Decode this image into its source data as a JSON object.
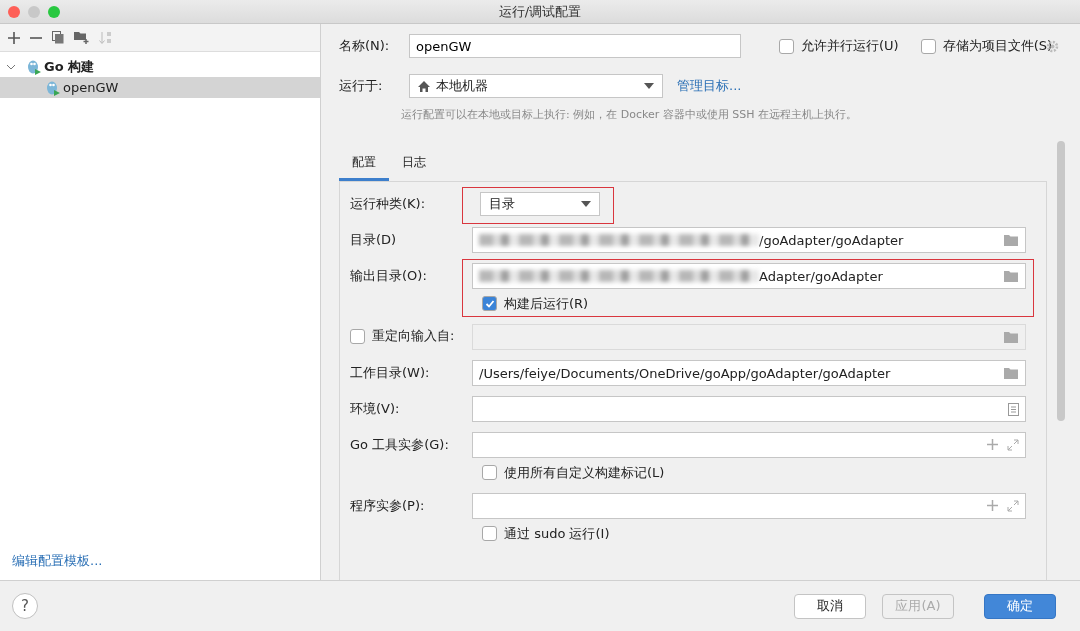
{
  "window": {
    "title": "运行/调试配置"
  },
  "tree": [
    {
      "label": "Go 构建",
      "expanded": true,
      "selected": false,
      "children": [
        {
          "label": "openGW",
          "selected": true
        }
      ]
    }
  ],
  "edit_templates_link": "编辑配置模板...",
  "name": {
    "label": "名称(N):",
    "value": "openGW"
  },
  "options": [
    {
      "label": "允许并行运行(U)",
      "checked": false
    },
    {
      "label": "存储为项目文件(S)",
      "checked": false
    }
  ],
  "run_on": {
    "label": "运行于:",
    "value": "本地机器",
    "link": "管理目标..."
  },
  "hint": "运行配置可以在本地或目标上执行: 例如，在 Docker 容器中或使用 SSH 在远程主机上执行。",
  "tabs": [
    {
      "label": "配置",
      "selected": true
    },
    {
      "label": "日志",
      "selected": false
    }
  ],
  "form": [
    {
      "kind": "select",
      "label": "运行种类(K):",
      "value": "目录",
      "highlighted": true
    },
    {
      "kind": "path",
      "label": "目录(D)",
      "value": "/goAdapter/goAdapter",
      "blurred": true,
      "highlighted": false
    },
    {
      "kind": "path",
      "label": "输出目录(O):",
      "value": "Adapter/goAdapter",
      "blurred": true,
      "highlighted": true,
      "option": {
        "label": "构建后运行(R)",
        "checked": true
      }
    },
    {
      "kind": "path",
      "label": "重定向输入自:",
      "checked": false,
      "disabled": true,
      "highlighted": false
    },
    {
      "kind": "path",
      "label": "工作目录(W):",
      "value": "/Users/feiye/Documents/OneDrive/goApp/goAdapter/goAdapter",
      "highlighted": false
    },
    {
      "kind": "env",
      "label": "环境(V):",
      "highlighted": false
    },
    {
      "kind": "args",
      "label": "Go 工具实参(G):",
      "highlighted": false,
      "option": {
        "label": "使用所有自定义构建标记(L)",
        "checked": false
      }
    },
    {
      "kind": "args",
      "label": "程序实参(P):",
      "highlighted": false,
      "option": {
        "label": "通过 sudo 运行(I)",
        "checked": false
      }
    }
  ],
  "help": "?",
  "buttons": [
    {
      "label": "取消",
      "kind": "default",
      "disabled": false
    },
    {
      "label": "应用(A)",
      "kind": "default",
      "disabled": true
    },
    {
      "label": "确定",
      "kind": "primary",
      "disabled": false
    }
  ]
}
